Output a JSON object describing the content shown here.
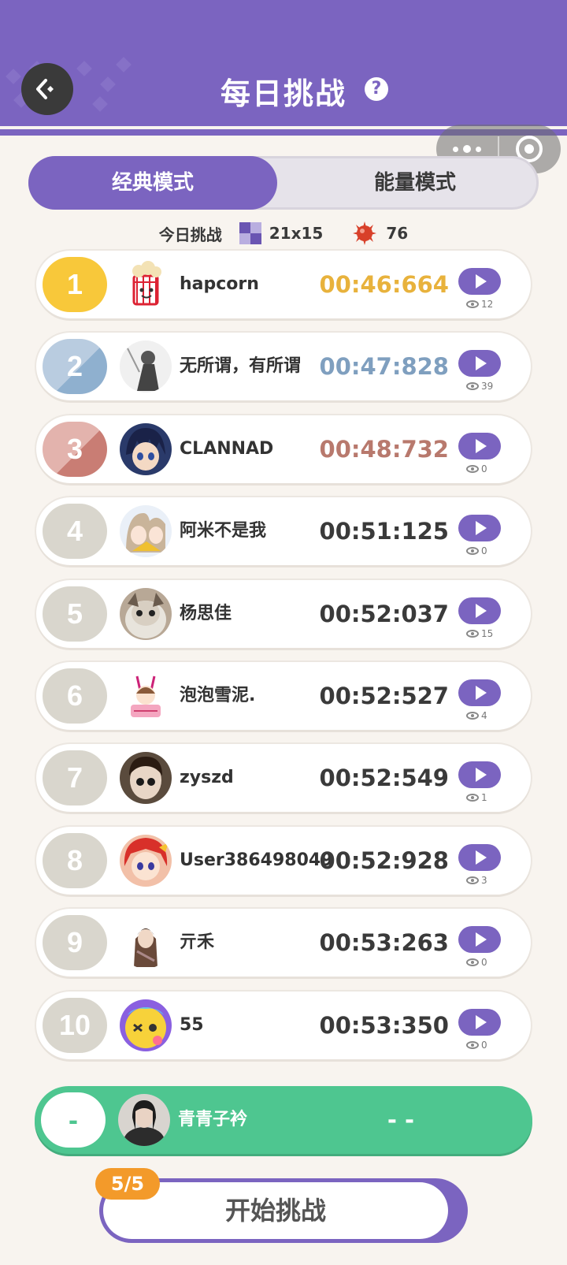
{
  "header": {
    "title": "每日挑战",
    "help_icon": "question-circle-icon",
    "back_icon": "back-arrow-icon",
    "accent_color": "#7b64c0"
  },
  "capsule": {
    "more_icon": "more-dots-icon",
    "close_icon": "target-circle-icon"
  },
  "modes": {
    "active": "经典模式",
    "inactive": "能量模式"
  },
  "today": {
    "label": "今日挑战",
    "grid_size": "21x15",
    "mine_count": "76"
  },
  "ranking": [
    {
      "rank": "1",
      "name": "hapcorn",
      "time": "00:46:664",
      "views": "12",
      "tier": "gold"
    },
    {
      "rank": "2",
      "name": "无所谓，有所谓",
      "time": "00:47:828",
      "views": "39",
      "tier": "silver"
    },
    {
      "rank": "3",
      "name": "CLANNAD",
      "time": "00:48:732",
      "views": "0",
      "tier": "bronze"
    },
    {
      "rank": "4",
      "name": "阿米不是我",
      "time": "00:51:125",
      "views": "0",
      "tier": "normal"
    },
    {
      "rank": "5",
      "name": "杨思佳",
      "time": "00:52:037",
      "views": "15",
      "tier": "normal"
    },
    {
      "rank": "6",
      "name": "泡泡雪泥.",
      "time": "00:52:527",
      "views": "4",
      "tier": "normal"
    },
    {
      "rank": "7",
      "name": "zyszd",
      "time": "00:52:549",
      "views": "1",
      "tier": "normal"
    },
    {
      "rank": "8",
      "name": "User386498049",
      "time": "00:52:928",
      "views": "3",
      "tier": "normal"
    },
    {
      "rank": "9",
      "name": "亓禾",
      "time": "00:53:263",
      "views": "0",
      "tier": "normal"
    },
    {
      "rank": "10",
      "name": "55",
      "time": "00:53:350",
      "views": "0",
      "tier": "normal"
    }
  ],
  "self": {
    "rank": "-",
    "name": "青青子衿",
    "time": "- -"
  },
  "start": {
    "attempts": "5/5",
    "label": "开始挑战"
  }
}
